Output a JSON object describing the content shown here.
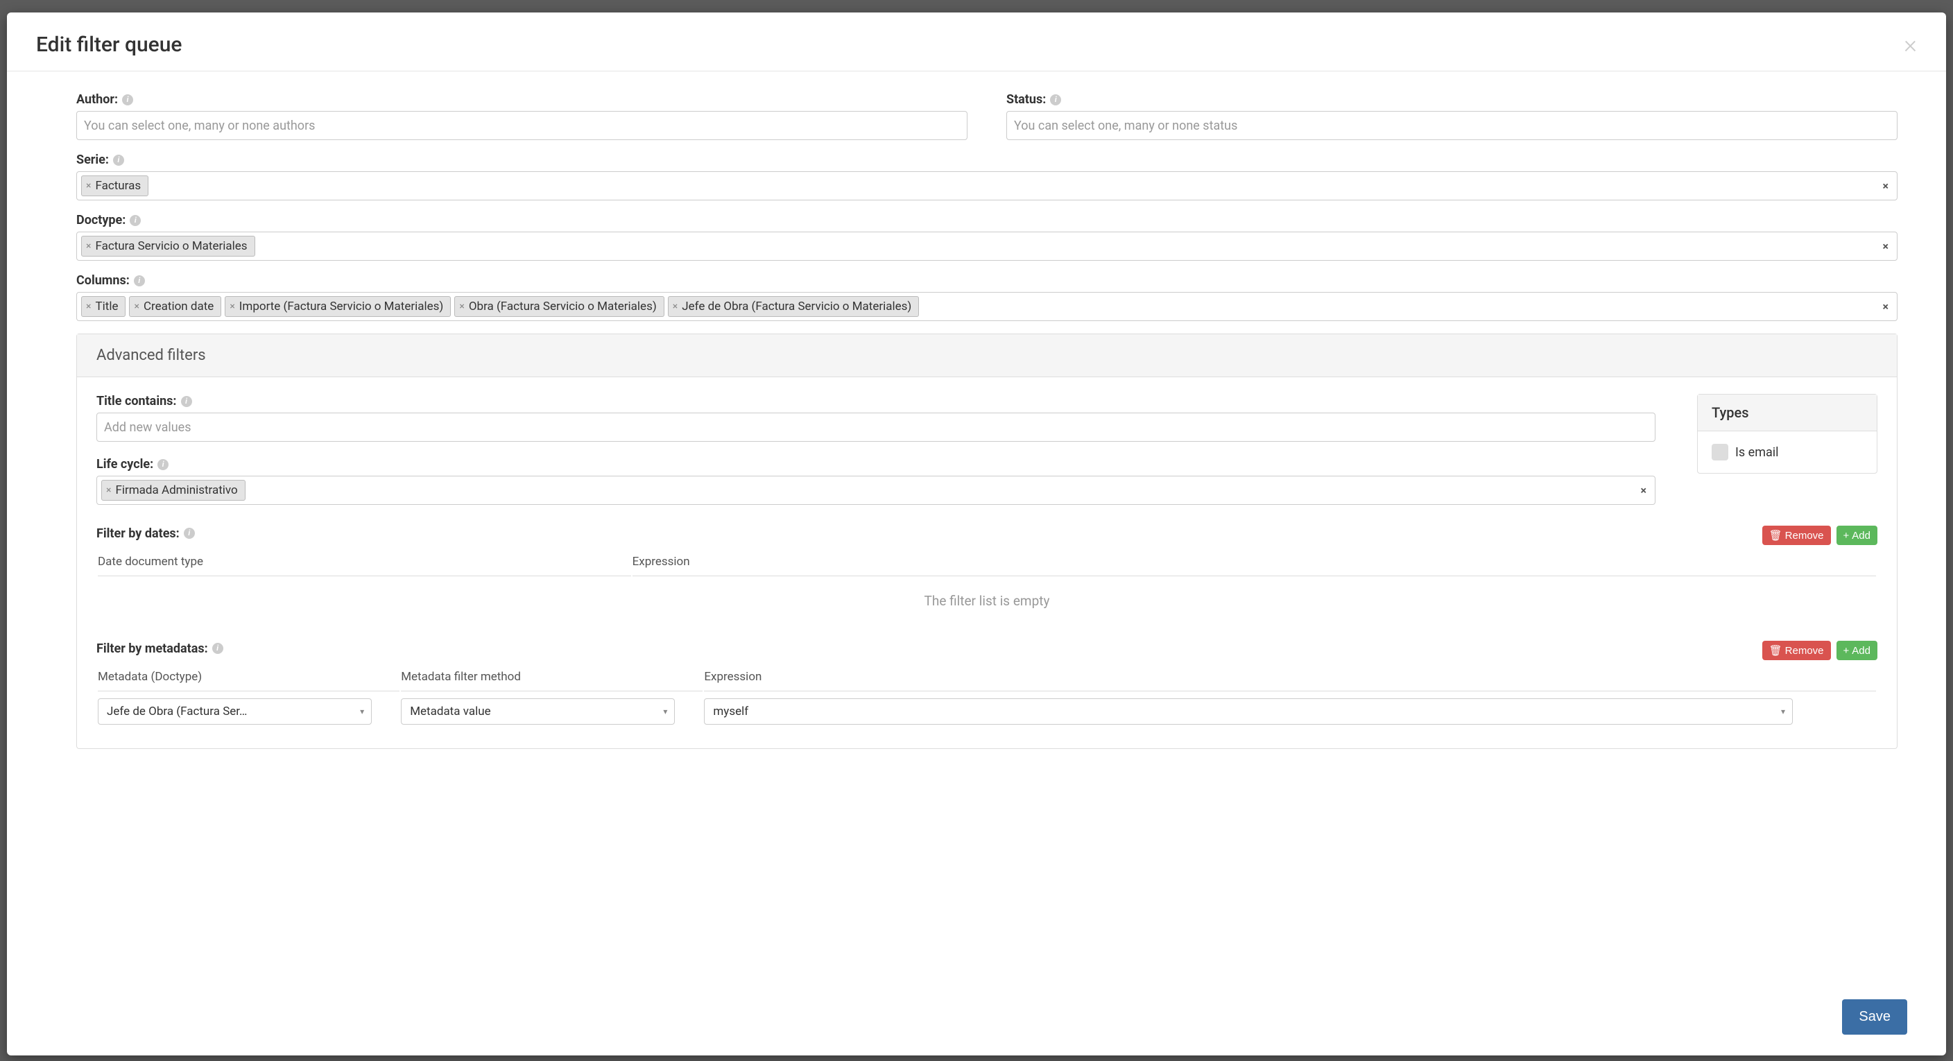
{
  "modal": {
    "title": "Edit filter queue"
  },
  "fields": {
    "author": {
      "label": "Author:",
      "placeholder": "You can select one, many or none authors"
    },
    "status": {
      "label": "Status:",
      "placeholder": "You can select one, many or none status"
    },
    "serie": {
      "label": "Serie:",
      "tags": [
        "Facturas"
      ]
    },
    "doctype": {
      "label": "Doctype:",
      "tags": [
        "Factura Servicio o Materiales"
      ]
    },
    "columns": {
      "label": "Columns:",
      "tags": [
        "Title",
        "Creation date",
        "Importe (Factura Servicio o Materiales)",
        "Obra (Factura Servicio o Materiales)",
        "Jefe de Obra (Factura Servicio o Materiales)"
      ]
    }
  },
  "advanced": {
    "title": "Advanced filters",
    "titleContains": {
      "label": "Title contains:",
      "placeholder": "Add new values"
    },
    "lifeCycle": {
      "label": "Life cycle:",
      "tags": [
        "Firmada Administrativo"
      ]
    },
    "types": {
      "header": "Types",
      "isEmailLabel": "Is email"
    },
    "filterByDates": {
      "label": "Filter by dates:",
      "removeLabel": "Remove",
      "addLabel": "Add",
      "col1": "Date document type",
      "col2": "Expression",
      "emptyText": "The filter list is empty"
    },
    "filterByMeta": {
      "label": "Filter by metadatas:",
      "removeLabel": "Remove",
      "addLabel": "Add",
      "col1": "Metadata (Doctype)",
      "col2": "Metadata filter method",
      "col3": "Expression",
      "row": {
        "metaDoctype": "Jefe de Obra (Factura Ser…",
        "method": "Metadata value",
        "expression": "myself"
      }
    }
  },
  "footer": {
    "saveLabel": "Save"
  }
}
